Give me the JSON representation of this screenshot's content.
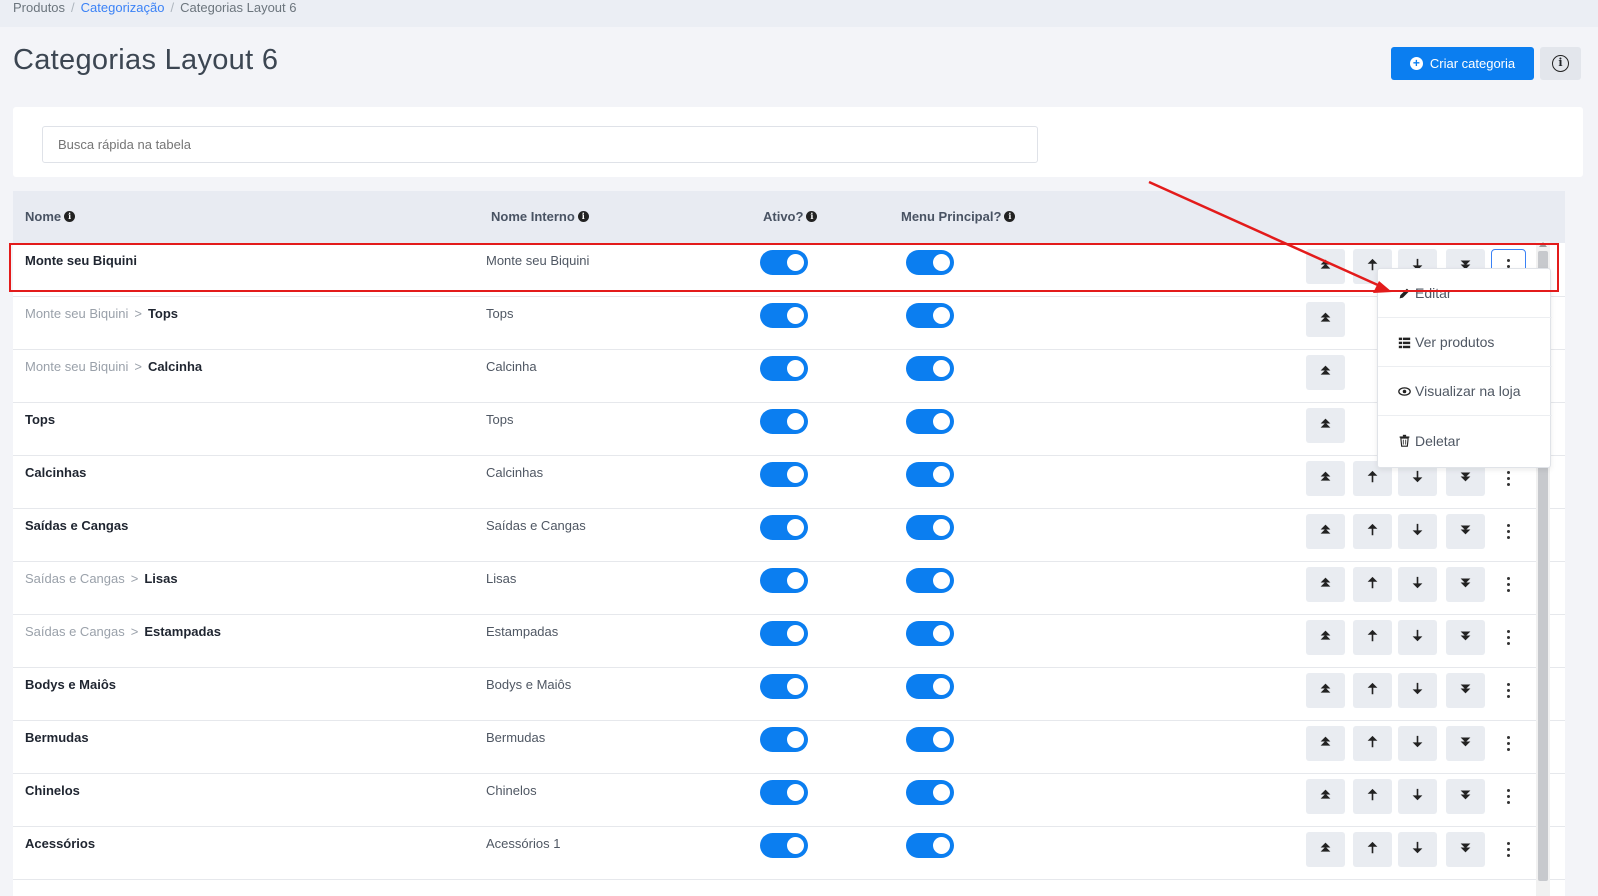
{
  "breadcrumb": {
    "items": [
      "Produtos",
      "Categorização",
      "Categorias Layout 6"
    ],
    "separator": "/"
  },
  "page": {
    "title": "Categorias Layout 6",
    "create_label": "Criar categoria",
    "info_label": "i"
  },
  "search": {
    "placeholder": "Busca rápida na tabela"
  },
  "table": {
    "headers": [
      "Nome",
      "Nome Interno",
      "Ativo?",
      "Menu Principal?"
    ],
    "rows": [
      {
        "parent": "",
        "name": "Monte seu Biquini",
        "internal": "Monte seu Biquini",
        "active": true,
        "menu": true,
        "controls": "full"
      },
      {
        "parent": "Monte seu Biquini",
        "name": "Tops",
        "internal": "Tops",
        "active": true,
        "menu": true,
        "controls": "top"
      },
      {
        "parent": "Monte seu Biquini",
        "name": "Calcinha",
        "internal": "Calcinha",
        "active": true,
        "menu": true,
        "controls": "top"
      },
      {
        "parent": "",
        "name": "Tops",
        "internal": "Tops",
        "active": true,
        "menu": true,
        "controls": "top"
      },
      {
        "parent": "",
        "name": "Calcinhas",
        "internal": "Calcinhas",
        "active": true,
        "menu": true,
        "controls": "full"
      },
      {
        "parent": "",
        "name": "Saídas e Cangas",
        "internal": "Saídas e Cangas",
        "active": true,
        "menu": true,
        "controls": "full"
      },
      {
        "parent": "Saídas e Cangas",
        "name": "Lisas",
        "internal": "Lisas",
        "active": true,
        "menu": true,
        "controls": "full"
      },
      {
        "parent": "Saídas e Cangas",
        "name": "Estampadas",
        "internal": "Estampadas",
        "active": true,
        "menu": true,
        "controls": "full"
      },
      {
        "parent": "",
        "name": "Bodys e Maiôs",
        "internal": "Bodys e Maiôs",
        "active": true,
        "menu": true,
        "controls": "full"
      },
      {
        "parent": "",
        "name": "Bermudas",
        "internal": "Bermudas",
        "active": true,
        "menu": true,
        "controls": "full"
      },
      {
        "parent": "",
        "name": "Chinelos",
        "internal": "Chinelos",
        "active": true,
        "menu": true,
        "controls": "full"
      },
      {
        "parent": "",
        "name": "Acessórios",
        "internal": "Acessórios 1",
        "active": true,
        "menu": true,
        "controls": "full"
      }
    ]
  },
  "dropdown": {
    "items": [
      {
        "label": "Editar",
        "icon": "pencil-icon"
      },
      {
        "label": "Ver produtos",
        "icon": "grid-list-icon"
      },
      {
        "label": "Visualizar na loja",
        "icon": "eye-icon"
      },
      {
        "label": "Deletar",
        "icon": "trash-icon"
      }
    ]
  },
  "colors": {
    "accent": "#0b7ef0",
    "annotation": "#e31b1b",
    "header_bg": "#e8ebf2"
  }
}
